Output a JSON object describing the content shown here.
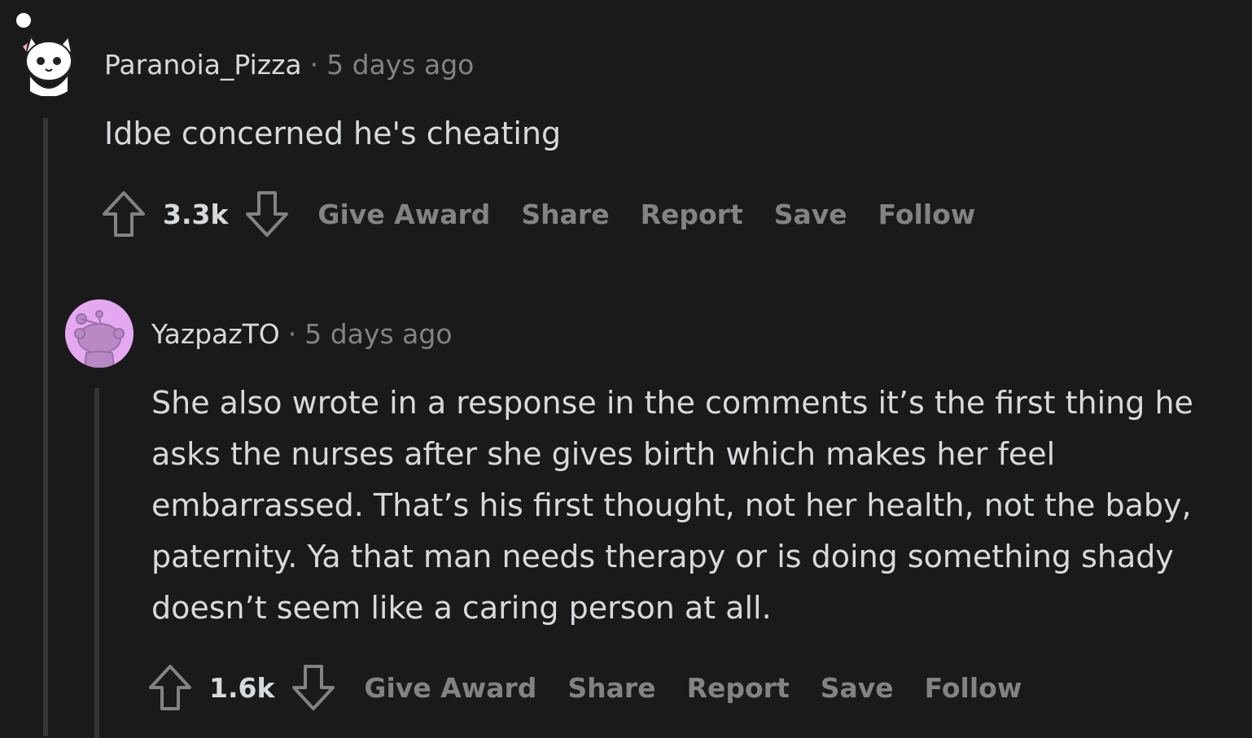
{
  "comments": [
    {
      "username": "Paranoia_Pizza",
      "separator": "·",
      "time": "5 days ago",
      "body": "Idbe concerned he's cheating",
      "score": "3.3k",
      "actions": [
        "Give Award",
        "Share",
        "Report",
        "Save",
        "Follow"
      ],
      "avatar_icon": "snoo-cat-avatar-icon"
    },
    {
      "username": "YazpazTO",
      "separator": "·",
      "time": "5 days ago",
      "body": "She also wrote in a response in the comments it’s the first thing he asks the nurses after she gives birth which makes her feel embarrassed. That’s his first thought, not her health, not the baby, paternity. Ya that man needs therapy or is doing something shady doesn’t seem like a caring person at all.",
      "score": "1.6k",
      "actions": [
        "Give Award",
        "Share",
        "Report",
        "Save",
        "Follow"
      ],
      "avatar_icon": "default-snoo-avatar-icon"
    }
  ],
  "colors": {
    "background": "#1a1a1b",
    "text": "#d7dadc",
    "muted": "#818384",
    "thread_line": "#343536",
    "avatar2_bg": "#e4a8f0"
  }
}
